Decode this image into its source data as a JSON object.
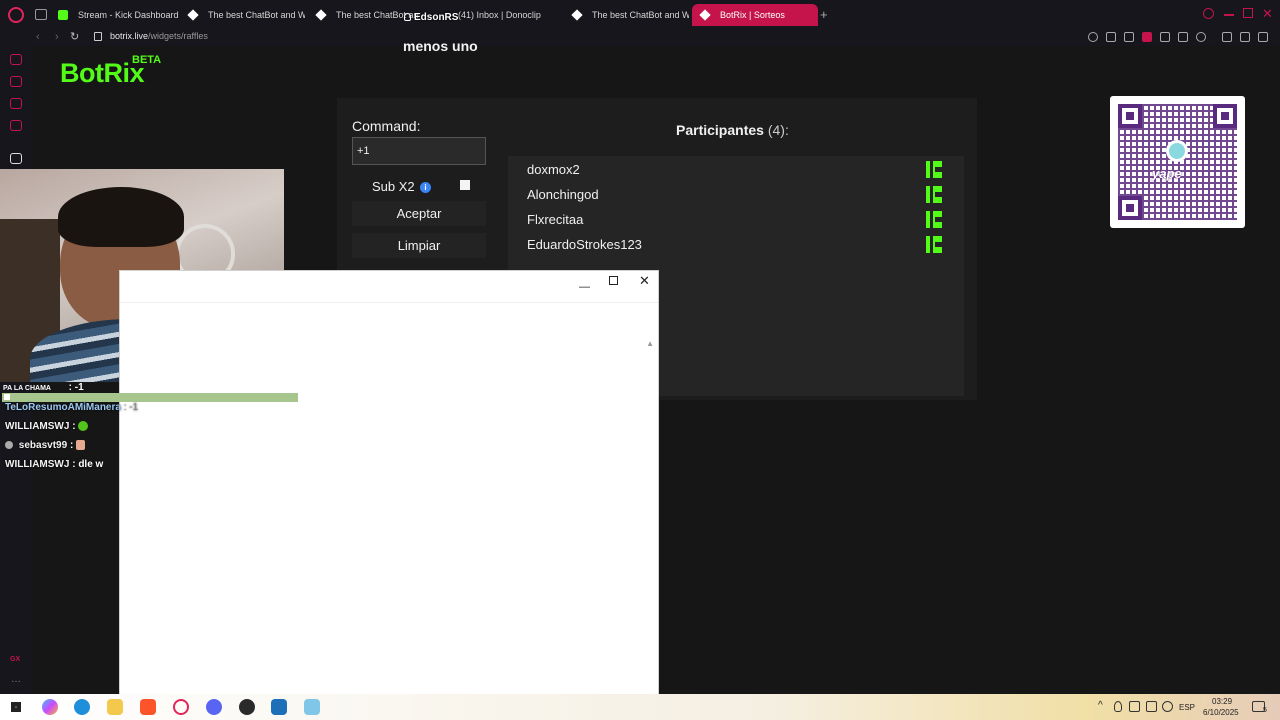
{
  "browser": {
    "tabs": [
      {
        "label": "Stream - Kick Dashboard",
        "icon": "kick-icon"
      },
      {
        "label": "The best ChatBot and Wi",
        "icon": "botrix-icon"
      },
      {
        "label": "The best ChatBot and Wi",
        "icon": "botrix-icon"
      },
      {
        "label": "(41) Inbox | Donoclip",
        "icon": "donoclip-icon"
      },
      {
        "label": "The best ChatBot and Wi",
        "icon": "botrix-icon"
      },
      {
        "label": "BotRix | Sorteos",
        "icon": "botrix-icon",
        "active": true
      }
    ],
    "url_host": "botrix.live",
    "url_path": "/widgets/raffles",
    "accent_color": "#c4144b"
  },
  "overlay": {
    "streamer_name": "EdsonRS",
    "top_text": "menos uno"
  },
  "page": {
    "brand": "BotRix",
    "brand_badge": "BETA",
    "command_label": "Command:",
    "command_value": "+1",
    "sub_x2_label": "Sub X2",
    "accept_button": "Aceptar",
    "clear_button": "Limpiar",
    "participants_title": "Participantes",
    "participants_count": "(4):",
    "participants": [
      {
        "name": "doxmox2"
      },
      {
        "name": "Alonchingod"
      },
      {
        "name": "Flxrecitaa"
      },
      {
        "name": "EduardoStrokes123"
      }
    ],
    "qr_label": "yape",
    "brand_color": "#53fc18"
  },
  "chat": {
    "header": "PA LA CHAMA",
    "header_suffix": ": -1",
    "lines": [
      {
        "user": "TeLoResumoAMiManera",
        "msg": ": -1"
      },
      {
        "user": "WILLIAMSWJ",
        "msg": ":"
      },
      {
        "user": "sebasvt99",
        "msg": ":"
      },
      {
        "user": "WILLIAMSWJ",
        "msg": ": dle w"
      }
    ]
  },
  "taskbar": {
    "language": "ESP",
    "time": "03:29",
    "date": "6/10/2025",
    "notification_count": "5"
  }
}
